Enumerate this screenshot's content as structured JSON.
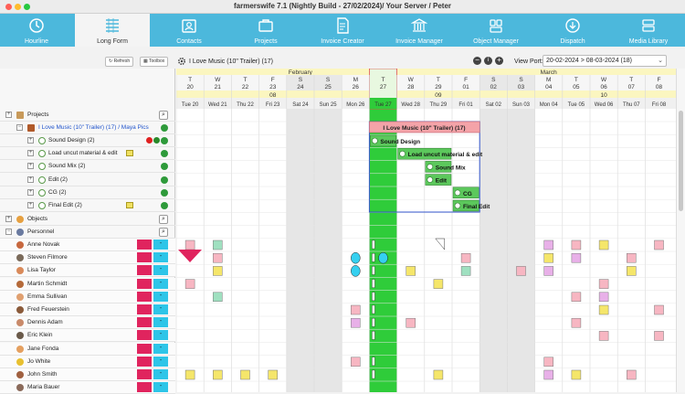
{
  "window": {
    "title": "farmerswife 7.1  (Nightly Build - 27/02/2024)/ Your Server / Peter"
  },
  "toolbar": {
    "items": [
      {
        "label": "Hourline",
        "icon": "clock-icon"
      },
      {
        "label": "Long Form",
        "icon": "list-icon"
      },
      {
        "label": "Contacts",
        "icon": "contacts-icon"
      },
      {
        "label": "Projects",
        "icon": "briefcase-icon"
      },
      {
        "label": "Invoice Creator",
        "icon": "invoice-icon"
      },
      {
        "label": "Invoice Manager",
        "icon": "bank-icon"
      },
      {
        "label": "Object Manager",
        "icon": "objects-icon"
      },
      {
        "label": "Dispatch",
        "icon": "dispatch-icon"
      },
      {
        "label": "Media Library",
        "icon": "media-icon"
      }
    ],
    "active_index": 1
  },
  "subbar": {
    "refresh": "Refresh",
    "toolbox": "Toolbox",
    "current_project": "I Love Music (10\" Trailer) (17)",
    "viewport_label": "View Port:",
    "viewport_value": "20-02-2024 > 08-03-2024 (18)"
  },
  "tree": {
    "projects": "Projects",
    "project": "I Love Music (10\" Trailer) (17) / Maya Pics",
    "tasks": [
      "Sound Design (2)",
      "Load uncut material & edit",
      "Sound Mix (2)",
      "Edit (2)",
      "CG (2)",
      "Final Edit (2)"
    ],
    "objects": "Objects",
    "personnel": "Personnel",
    "people": [
      "Anne Novak",
      "Steven Filmore",
      "Lisa Taylor",
      "Martin Schmidt",
      "Emma Sullivan",
      "Fred Feuerstein",
      "Dennis Adam",
      "Eric Klein",
      "Jane Fonda",
      "Jo White",
      "John Smith",
      "Maria Bauer"
    ],
    "dash": "-"
  },
  "calendar": {
    "months": [
      "February",
      "March"
    ],
    "weekdays": [
      "T",
      "W",
      "T",
      "F",
      "S",
      "S",
      "M",
      "T",
      "W",
      "T",
      "F",
      "S",
      "S",
      "M",
      "T",
      "W",
      "T",
      "F"
    ],
    "day_numbers": [
      "20",
      "21",
      "22",
      "23",
      "24",
      "25",
      "26",
      "27",
      "28",
      "29",
      "01",
      "02",
      "03",
      "04",
      "05",
      "06",
      "07",
      "08"
    ],
    "weeks": [
      "08",
      "09",
      "10"
    ],
    "day_labels": [
      "Tue 20",
      "Wed 21",
      "Thu 22",
      "Fri 23",
      "Sat 24",
      "Sun 25",
      "Mon 26",
      "Tue 27",
      "Wed 28",
      "Thu 29",
      "Fri 01",
      "Sat 02",
      "Sun 03",
      "Mon 04",
      "Tue 05",
      "Wed 06",
      "Thu 07",
      "Fri 08"
    ],
    "today_index": 7,
    "weekend_indices": [
      4,
      5,
      11,
      12
    ]
  },
  "gantt": {
    "project_bar": "I Love Music (10\" Trailer) (17)",
    "tasks": [
      {
        "label": "Sound Design",
        "start": 7,
        "end": 8
      },
      {
        "label": "Load uncut material & edit",
        "start": 8,
        "end": 10
      },
      {
        "label": "Sound Mix",
        "start": 9,
        "end": 10
      },
      {
        "label": "Edit",
        "start": 9,
        "end": 10
      },
      {
        "label": "CG",
        "start": 10,
        "end": 11
      },
      {
        "label": "Final Edit",
        "start": 10,
        "end": 11
      }
    ]
  },
  "colors": {
    "toolbar": "#4cb8dc",
    "today": "#2fcc3a",
    "selection": "#3355cc",
    "project_bar": "#f4a3a8",
    "task_green": "#5cc85c"
  }
}
